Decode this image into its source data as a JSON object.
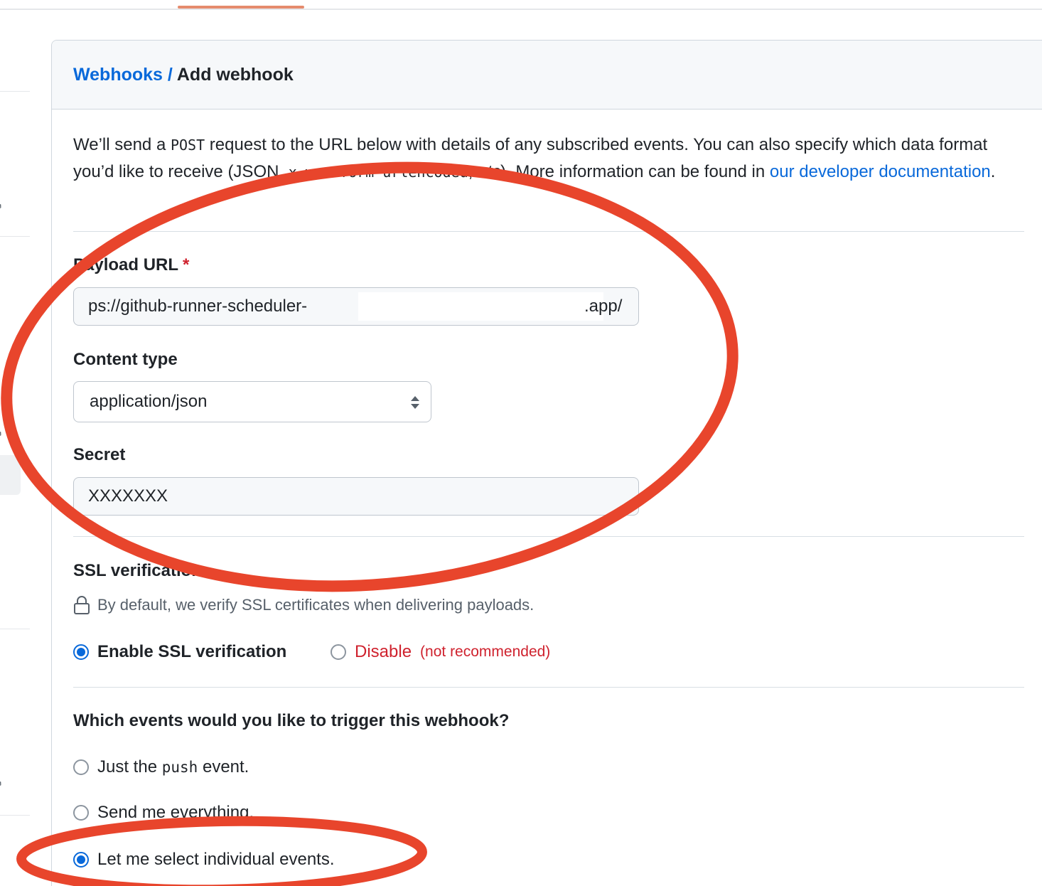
{
  "breadcrumb": {
    "parent": "Webhooks",
    "separator": " / ",
    "current": "Add webhook"
  },
  "intro": {
    "part1": "We’ll send a ",
    "post_code": "POST",
    "part2": " request to the URL below with details of any subscribed events. You can also specify which data format you’d like to receive (JSON, ",
    "form_code": "x-www-form-urlencoded",
    "part3": ", ",
    "etc": "etc",
    "part4": "). More information can be found in ",
    "link": "our developer documentation",
    "end": "."
  },
  "payload_url": {
    "label": "Payload URL",
    "required_mark": "*",
    "value_prefix": "ps://github-runner-scheduler-",
    "value_suffix": ".app/"
  },
  "content_type": {
    "label": "Content type",
    "selected": "application/json"
  },
  "secret": {
    "label": "Secret",
    "value": "XXXXXXX"
  },
  "ssl": {
    "label": "SSL verification",
    "help": "By default, we verify SSL certificates when delivering payloads.",
    "options": [
      {
        "label": "Enable SSL verification",
        "checked": true
      },
      {
        "label": "Disable",
        "note": "(not recommended)",
        "checked": false
      }
    ]
  },
  "events": {
    "question": "Which events would you like to trigger this webhook?",
    "option1_prefix": "Just the ",
    "option1_code": "push",
    "option1_suffix": " event.",
    "option2": "Send me everything.",
    "option3": "Let me select individual events.",
    "selected": "Let me select individual events."
  },
  "colors": {
    "link": "#0969da",
    "danger": "#cf222e",
    "annotation": "#e8452c"
  }
}
